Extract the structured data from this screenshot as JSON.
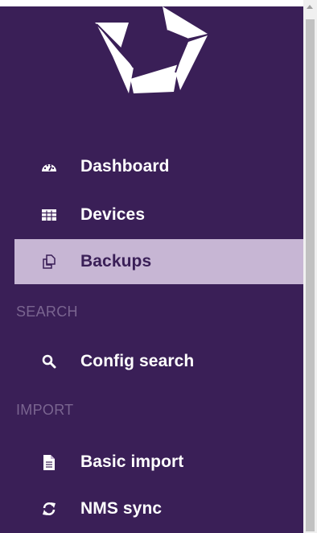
{
  "sidebar": {
    "logo": {
      "icon": "brand-logo"
    },
    "items": [
      {
        "label": "Dashboard",
        "icon": "dashboard-gauge-icon",
        "active": false
      },
      {
        "label": "Devices",
        "icon": "table-grid-icon",
        "active": false
      },
      {
        "label": "Backups",
        "icon": "copy-icon",
        "active": true
      }
    ],
    "sections": [
      {
        "title": "SEARCH",
        "items": [
          {
            "label": "Config search",
            "icon": "search-icon",
            "active": false
          }
        ]
      },
      {
        "title": "IMPORT",
        "items": [
          {
            "label": "Basic import",
            "icon": "file-icon",
            "active": false
          },
          {
            "label": "NMS sync",
            "icon": "sync-icon",
            "active": false
          }
        ]
      }
    ]
  },
  "colors": {
    "sidebar_bg": "#3a1f57",
    "active_bg": "#c7b6d4",
    "section_label": "#7a6590",
    "text": "#ffffff"
  }
}
